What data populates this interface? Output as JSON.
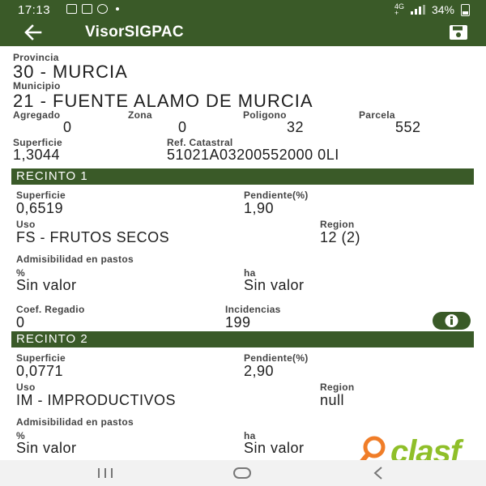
{
  "status": {
    "time": "17:13",
    "net_top": "4G",
    "net_bottom": "+",
    "battery": "34%"
  },
  "appbar": {
    "title": "VisorSIGPAC"
  },
  "location": {
    "provincia_label": "Provincia",
    "provincia_value": "30 - MURCIA",
    "municipio_label": "Municipio",
    "municipio_value": "21 - FUENTE ALAMO DE MURCIA",
    "agregado_label": "Agregado",
    "agregado_value": "0",
    "zona_label": "Zona",
    "zona_value": "0",
    "poligono_label": "Poligono",
    "poligono_value": "32",
    "parcela_label": "Parcela",
    "parcela_value": "552",
    "superficie_label": "Superficie",
    "superficie_value": "1,3044",
    "ref_label": "Ref. Catastral",
    "ref_value": "51021A03200552000 0LI"
  },
  "recinto1": {
    "header": "RECINTO 1",
    "superficie_label": "Superficie",
    "superficie_value": "0,6519",
    "pendiente_label": "Pendiente(%)",
    "pendiente_value": "1,90",
    "uso_label": "Uso",
    "uso_value": "FS - FRUTOS SECOS",
    "region_label": "Region",
    "region_value": "12 (2)",
    "admis_label": "Admisibilidad en pastos",
    "pct_label": "%",
    "pct_value": "Sin valor",
    "ha_label": "ha",
    "ha_value": "Sin valor",
    "coef_label": "Coef. Regadio",
    "coef_value": "0",
    "incid_label": "Incidencias",
    "incid_value": "199"
  },
  "recinto2": {
    "header": "RECINTO 2",
    "superficie_label": "Superficie",
    "superficie_value": "0,0771",
    "pendiente_label": "Pendiente(%)",
    "pendiente_value": "2,90",
    "uso_label": "Uso",
    "uso_value": "IM - IMPRODUCTIVOS",
    "region_label": "Region",
    "region_value": "null",
    "admis_label": "Admisibilidad en pastos",
    "pct_label": "%",
    "pct_value": "Sin valor",
    "ha_label": "ha",
    "ha_value": "Sin valor"
  },
  "watermark": {
    "text": "clasf"
  },
  "colors": {
    "primary": "#3a5a28",
    "watermark_green": "#8fbf29",
    "watermark_orange": "#f07d28"
  },
  "icons": {
    "back": "arrow-left-icon",
    "save": "save-icon",
    "info": "info-icon"
  }
}
